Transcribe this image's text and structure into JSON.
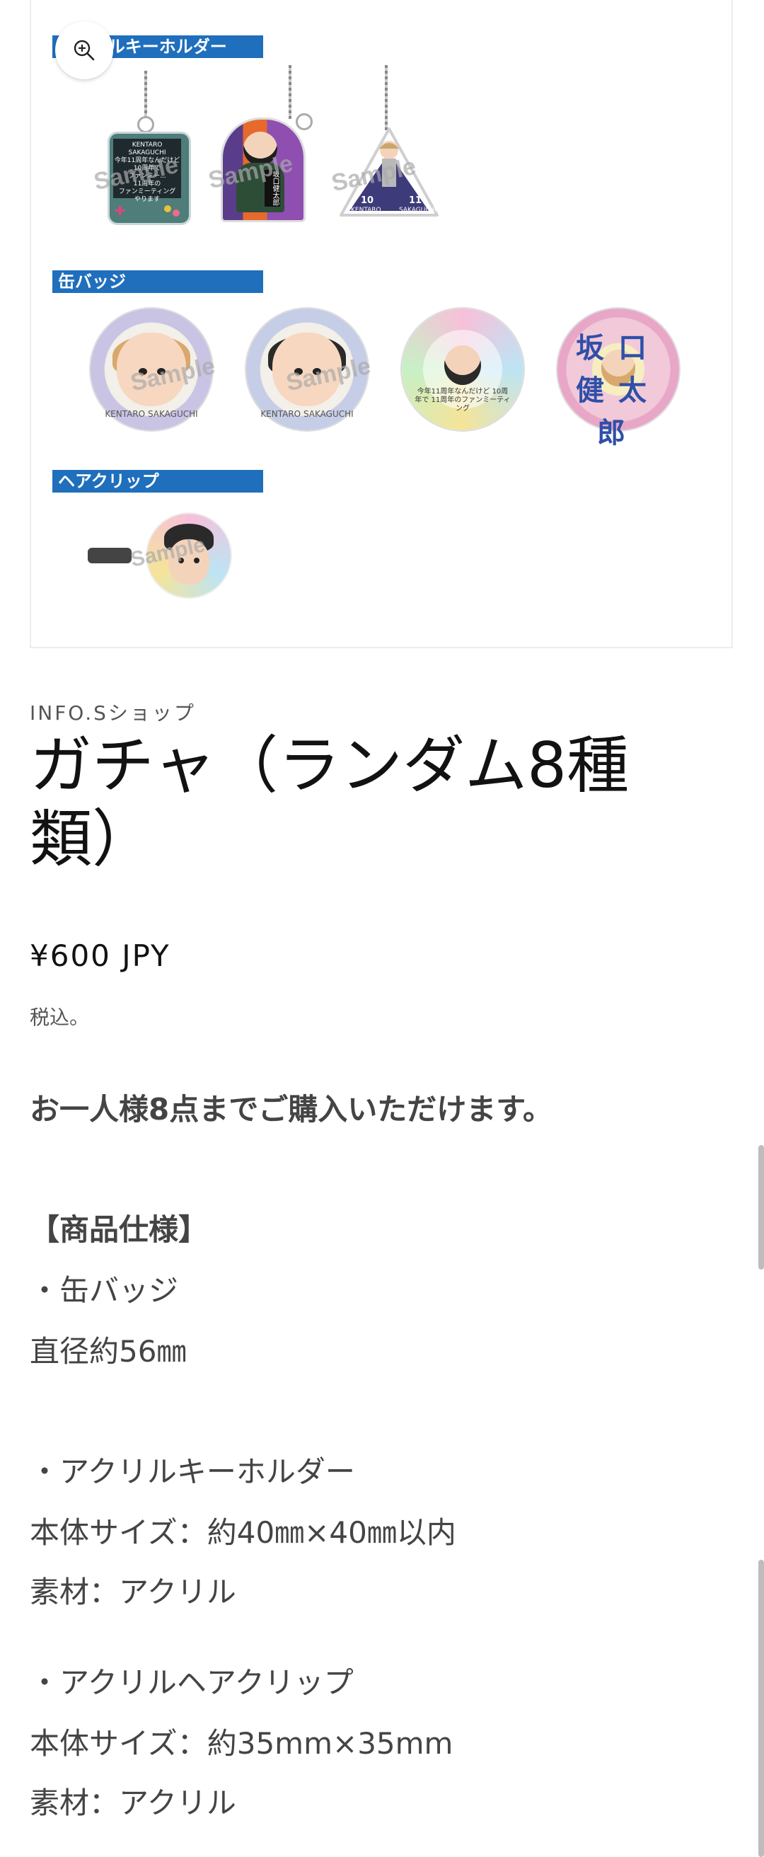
{
  "gallery": {
    "section_keyholder": "アクリルキーホルダー",
    "section_badge": "缶バッジ",
    "section_hairclip": "ヘアクリップ",
    "watermark": "Sample",
    "keyholder1_text": [
      "KENTARO SAKAGUCHI",
      "今年11周年なんだけど",
      "10周年で",
      "ファンミー...",
      "11周年の",
      "ファンミーティング",
      "やります"
    ],
    "keyholder2_text": "坂口健太郎",
    "keyholder3_text": [
      "10",
      "11",
      "KENTARO",
      "SAKAGUCHI"
    ],
    "badge_ring_text": "KENTARO SAKAGUCHI",
    "badge3_text": "今年11周年なんだけど 10周年で 11周年のファンミーティング",
    "badge4_text": "坂口健太郎"
  },
  "product": {
    "vendor": "INFO.Sショップ",
    "title": "ガチャ（ランダム8種類）",
    "price": "¥600 JPY",
    "tax_note": "税込。"
  },
  "description": {
    "limit": "お一人様8点までご購入いただけます。",
    "spec_heading": "【商品仕様】",
    "badge_item": "・缶バッジ",
    "badge_size": "直径約56㎜",
    "keyholder_item": "・アクリルキーホルダー",
    "keyholder_size": "本体サイズ：約40㎜×40㎜以内",
    "keyholder_material": "素材：アクリル",
    "hairclip_item": "・アクリルヘアクリップ",
    "hairclip_size": "本体サイズ：約35mm×35mm",
    "hairclip_material": "素材：アクリル"
  },
  "icons": {
    "zoom": "zoom-in-icon"
  },
  "colors": {
    "section_bar": "#1f6fbd",
    "text": "#121212"
  }
}
